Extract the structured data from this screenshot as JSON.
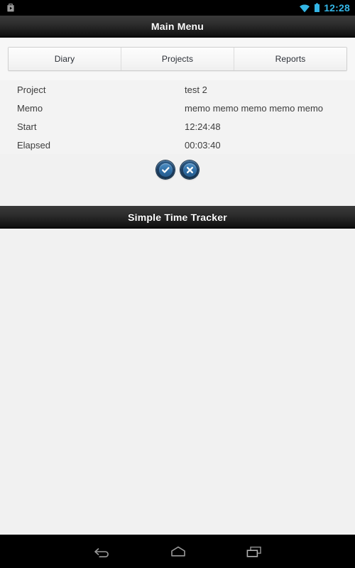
{
  "status_bar": {
    "notification_icon": "play-store-download-icon",
    "wifi_icon": "wifi-icon",
    "battery_icon": "battery-icon",
    "clock": "12:28",
    "accent_color": "#33b5e5",
    "background_color": "#000000"
  },
  "action_bar": {
    "title": "Main Menu"
  },
  "tabs": [
    {
      "label": "Diary",
      "selected": false
    },
    {
      "label": "Projects",
      "selected": false
    },
    {
      "label": "Reports",
      "selected": false
    }
  ],
  "details": {
    "rows": [
      {
        "label": "Project",
        "value": "test 2"
      },
      {
        "label": "Memo",
        "value": "memo memo memo memo memo"
      },
      {
        "label": "Start",
        "value": "12:24:48"
      },
      {
        "label": "Elapsed",
        "value": "00:03:40"
      }
    ]
  },
  "actions": {
    "confirm": {
      "icon": "check-icon",
      "label": "Confirm"
    },
    "cancel": {
      "icon": "close-icon",
      "label": "Cancel"
    },
    "button_color": "#2f6da4",
    "button_border_color": "#17324a"
  },
  "app_bar": {
    "title": "Simple Time Tracker"
  },
  "navigation_bar": {
    "back": {
      "icon": "back-arrow-icon",
      "label": "Back"
    },
    "home": {
      "icon": "home-icon",
      "label": "Home"
    },
    "recents": {
      "icon": "recents-icon",
      "label": "Recent apps"
    },
    "background_color": "#000000",
    "icon_color": "#9a9a9a"
  }
}
